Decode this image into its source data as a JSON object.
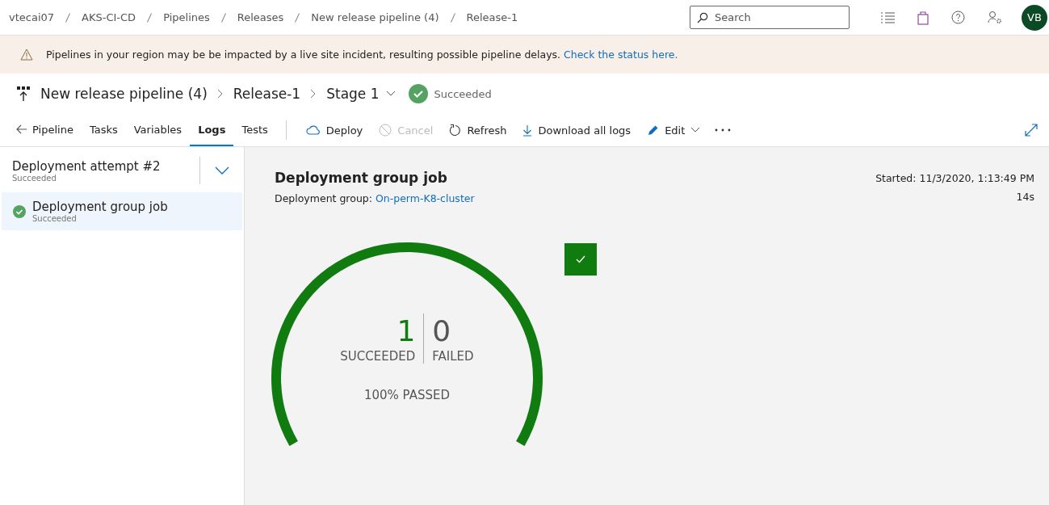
{
  "breadcrumbs": [
    "vtecai07",
    "AKS-CI-CD",
    "Pipelines",
    "Releases",
    "New release pipeline (4)",
    "Release-1"
  ],
  "search": {
    "placeholder": "Search"
  },
  "avatar": {
    "initials": "VB"
  },
  "banner": {
    "text": "Pipelines in your region may be be impacted by a live site incident, resulting possible pipeline delays.",
    "link": "Check the status here."
  },
  "header": {
    "pipeline": "New release pipeline (4)",
    "release": "Release-1",
    "stage": "Stage 1",
    "status": "Succeeded"
  },
  "tabs": [
    {
      "label": "Pipeline",
      "selected": false,
      "kind": "back"
    },
    {
      "label": "Tasks",
      "selected": false,
      "kind": "tab"
    },
    {
      "label": "Variables",
      "selected": false,
      "kind": "tab"
    },
    {
      "label": "Logs",
      "selected": true,
      "kind": "tab"
    },
    {
      "label": "Tests",
      "selected": false,
      "kind": "tab"
    }
  ],
  "actions": [
    {
      "label": "Deploy",
      "kind": "cloud",
      "disabled": false
    },
    {
      "label": "Cancel",
      "kind": "cancel",
      "disabled": true
    },
    {
      "label": "Refresh",
      "kind": "refresh",
      "disabled": false
    },
    {
      "label": "Download all logs",
      "kind": "download",
      "disabled": false
    },
    {
      "label": "Edit",
      "kind": "edit",
      "disabled": false
    }
  ],
  "attempt": {
    "title": "Deployment attempt #2",
    "status": "Succeeded"
  },
  "jobs": [
    {
      "name": "Deployment group job",
      "status": "Succeeded",
      "selected": true
    }
  ],
  "job": {
    "title": "Deployment group job",
    "group_label": "Deployment group:",
    "group_link": "On-perm-K8-cluster",
    "started": "Started: 11/3/2020, 1:13:49 PM",
    "duration": "14s"
  },
  "gauge": {
    "level": 1,
    "succeeded": "1",
    "succeeded_label": "SUCCEEDED",
    "failed": "0",
    "failed_label": "FAILED",
    "passed": "100% PASSED"
  }
}
